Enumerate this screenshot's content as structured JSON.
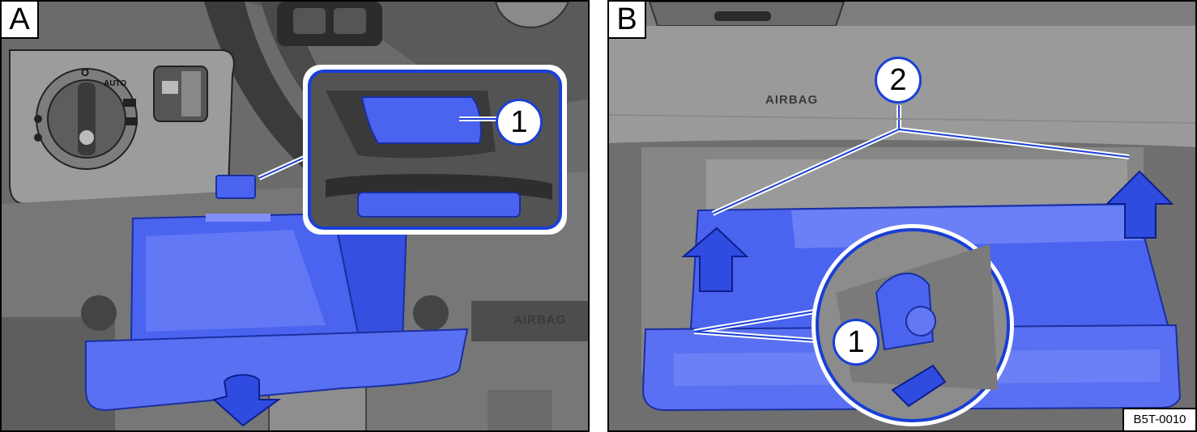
{
  "panel_a": {
    "letter": "A",
    "callout_1": "1",
    "airbag_label": "AIRBAG",
    "light_switch": {
      "off_label": "O",
      "auto_label": "AUTO"
    }
  },
  "panel_b": {
    "letter": "B",
    "callout_1": "1",
    "callout_2": "2",
    "airbag_label": "AIRBAG"
  },
  "figure_code": "B5T-0010",
  "colors": {
    "accent": "#1a3fd6",
    "highlight_blue": "#4a64f0",
    "dash_grey": "#6e6e6e"
  }
}
